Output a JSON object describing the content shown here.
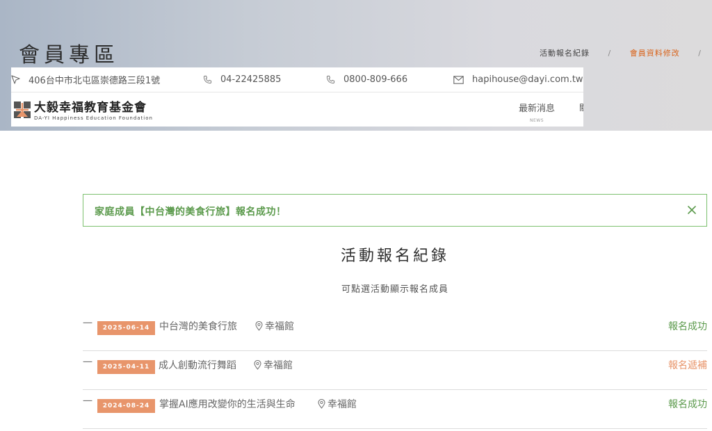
{
  "header": {
    "title": "會員專區",
    "breadcrumbs": [
      {
        "label": "活動報名紀錄",
        "active": false
      },
      {
        "label": "會員資料修改",
        "active": true
      }
    ]
  },
  "contact": {
    "address": "406台中市北屯區崇德路三段1號",
    "phone": "04-22425885",
    "tollfree": "0800-809-666",
    "email": "hapihouse@dayi.com.tw"
  },
  "brand": {
    "name_cn": "大毅幸福教育基金會",
    "name_en": "DA-YI Happiness Education Foundation"
  },
  "nav": [
    {
      "label": "最新消息",
      "sub": "NEWS"
    },
    {
      "label": "關",
      "sub": ""
    }
  ],
  "alert": {
    "message": "家庭成員【中台灣的美食行旅】報名成功！",
    "close_icon": "close-icon"
  },
  "section": {
    "title": "活動報名紀錄",
    "subtitle": "可點選活動顯示報名成員"
  },
  "records": [
    {
      "dash": "一",
      "date": "2025-06-14",
      "title": "中台灣的美食行旅",
      "location": "幸福館",
      "status": "報名成功"
    },
    {
      "dash": "一",
      "date": "2025-04-11",
      "title": "成人創動流行舞蹈",
      "location": "幸福館",
      "status": "報名遞補"
    },
    {
      "dash": "一",
      "date": "2024-08-24",
      "title": "掌握AI應用改變你的生活與生命",
      "location": "幸福館",
      "status": "報名成功"
    }
  ],
  "colors": {
    "accent_orange": "#d9631a",
    "date_badge": "#e8956b",
    "success_green": "#5b9a4c",
    "waitlist_orange": "#e8956b"
  }
}
